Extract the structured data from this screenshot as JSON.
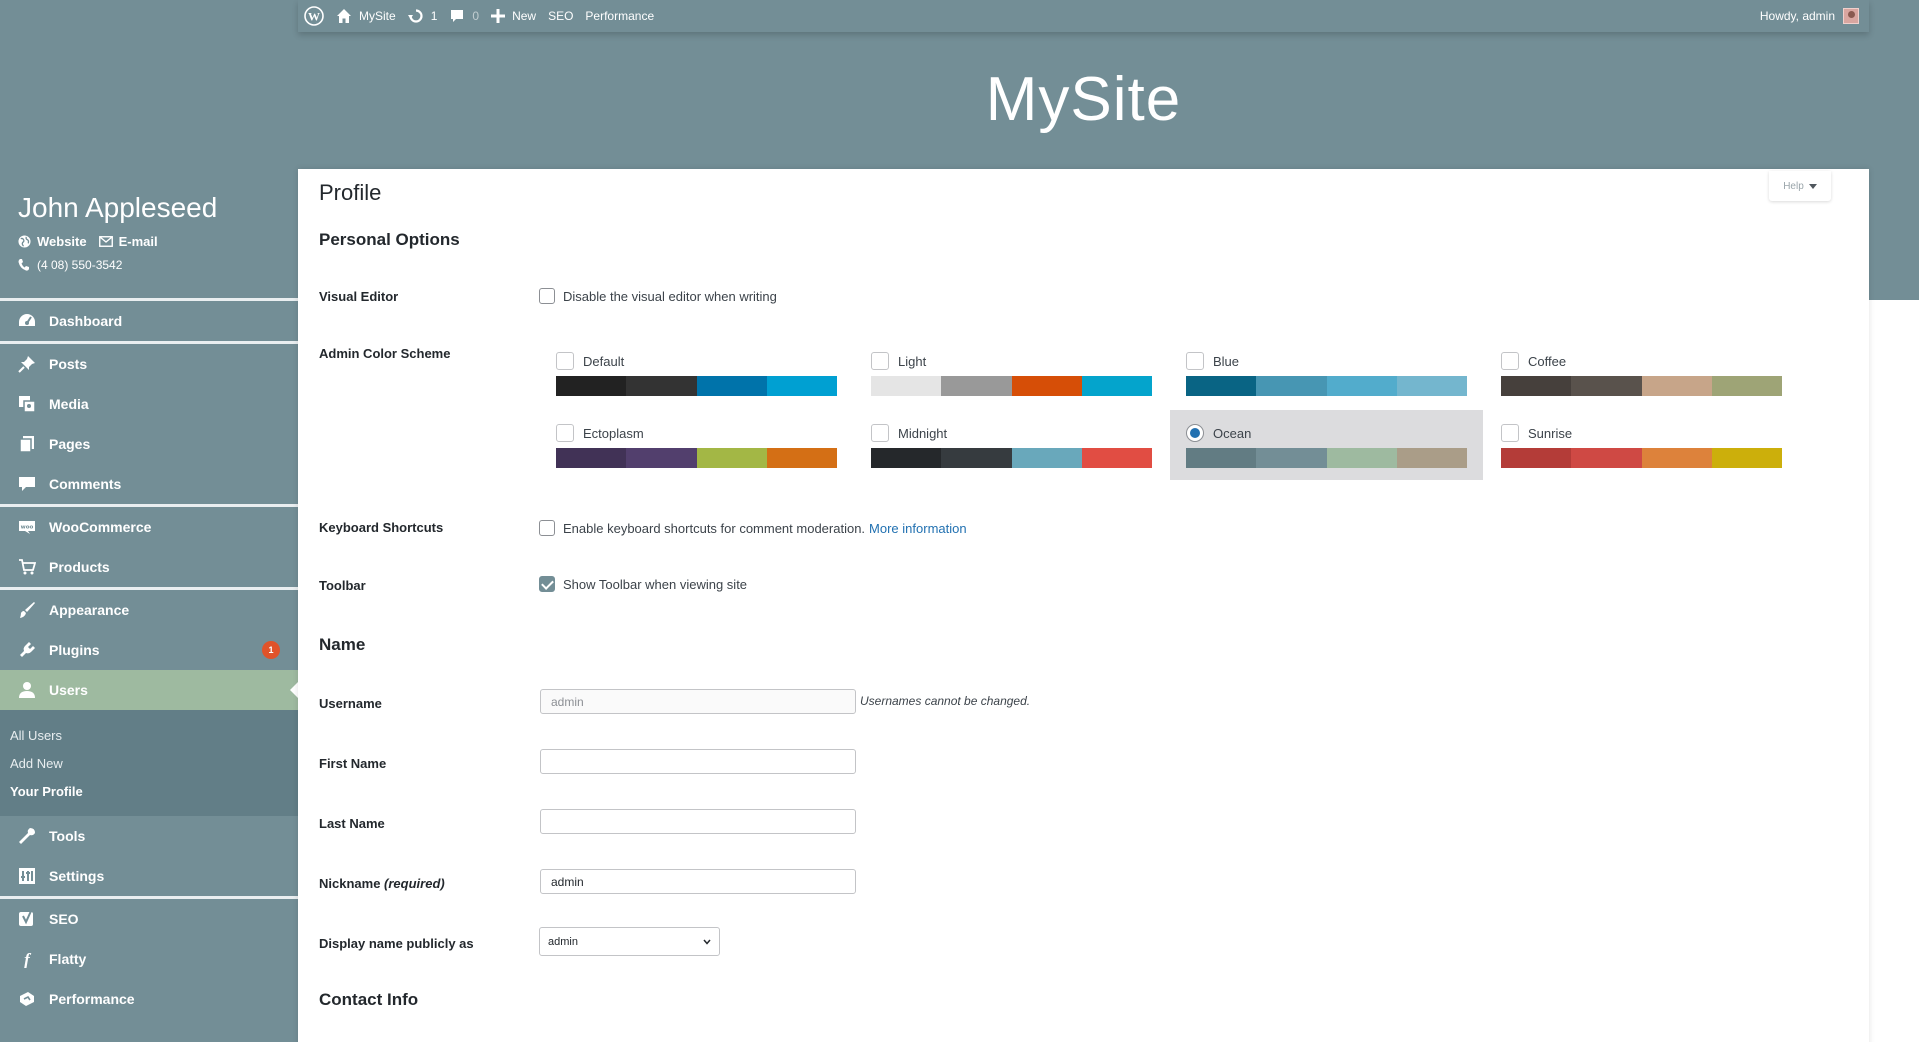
{
  "adminbar": {
    "site_name": "MySite",
    "updates_count": "1",
    "comments_count": "0",
    "new_label": "New",
    "seo_label": "SEO",
    "performance_label": "Performance",
    "greeting": "Howdy, admin"
  },
  "site_title": "MySite",
  "profile": {
    "name": "John Appleseed",
    "website_label": "Website",
    "email_label": "E-mail",
    "phone": "(4 08) 550-3542"
  },
  "sidebar": {
    "dashboard": "Dashboard",
    "posts": "Posts",
    "media": "Media",
    "pages": "Pages",
    "comments": "Comments",
    "woocommerce": "WooCommerce",
    "products": "Products",
    "appearance": "Appearance",
    "plugins": "Plugins",
    "plugins_badge": "1",
    "users": "Users",
    "sub_all_users": "All Users",
    "sub_add_new": "Add New",
    "sub_your_profile": "Your Profile",
    "tools": "Tools",
    "settings": "Settings",
    "seo": "SEO",
    "flatty": "Flatty",
    "performance": "Performance"
  },
  "help_label": "Help",
  "page_title": "Profile",
  "personal_options": {
    "heading": "Personal Options",
    "visual_editor_label": "Visual Editor",
    "visual_editor_text": "Disable the visual editor when writing",
    "color_scheme_label": "Admin Color Scheme",
    "keyboard_label": "Keyboard Shortcuts",
    "keyboard_text": "Enable keyboard shortcuts for comment moderation.",
    "keyboard_link": "More information",
    "toolbar_label": "Toolbar",
    "toolbar_text": "Show Toolbar when viewing site"
  },
  "color_schemes": [
    {
      "name": "Default",
      "colors": [
        "#222222",
        "#333333",
        "#0073aa",
        "#00a0d2"
      ],
      "selected": false
    },
    {
      "name": "Light",
      "colors": [
        "#e5e5e5",
        "#999999",
        "#d64e07",
        "#04a4cc"
      ],
      "selected": false
    },
    {
      "name": "Blue",
      "colors": [
        "#096484",
        "#4796b3",
        "#52accc",
        "#74b6ce"
      ],
      "selected": false
    },
    {
      "name": "Coffee",
      "colors": [
        "#46403c",
        "#59524c",
        "#c7a589",
        "#9ea476"
      ],
      "selected": false
    },
    {
      "name": "Ectoplasm",
      "colors": [
        "#413256",
        "#523f6d",
        "#a3b745",
        "#d46f15"
      ],
      "selected": false
    },
    {
      "name": "Midnight",
      "colors": [
        "#25282b",
        "#363b3f",
        "#69a8bb",
        "#e14d43"
      ],
      "selected": false
    },
    {
      "name": "Ocean",
      "colors": [
        "#627c83",
        "#738e96",
        "#9ebaa0",
        "#aa9d88"
      ],
      "selected": true
    },
    {
      "name": "Sunrise",
      "colors": [
        "#b43c38",
        "#cf4944",
        "#dd823b",
        "#ccaf0b"
      ],
      "selected": false
    }
  ],
  "name_section": {
    "heading": "Name",
    "username_label": "Username",
    "username_value": "admin",
    "username_note": "Usernames cannot be changed.",
    "first_name_label": "First Name",
    "first_name_value": "",
    "last_name_label": "Last Name",
    "last_name_value": "",
    "nickname_label": "Nickname",
    "nickname_required": "(required)",
    "nickname_value": "admin",
    "display_label": "Display name publicly as",
    "display_value": "admin"
  },
  "contact_heading": "Contact Info"
}
